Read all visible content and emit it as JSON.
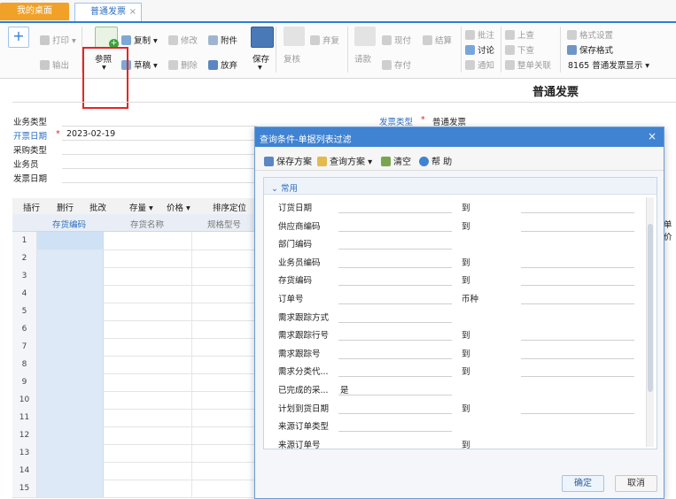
{
  "tabs": [
    {
      "label": "我的桌面"
    },
    {
      "label": "普通发票",
      "close": "×"
    }
  ],
  "toolbar": {
    "add": "+",
    "print": "打印",
    "export": "输出",
    "reference": "参照",
    "copy": "复制",
    "draft": "草稿",
    "modify": "修改",
    "delete": "删除",
    "attach": "附件",
    "abandon": "放弃",
    "save": "保存",
    "audit": "复核",
    "archive": "弃复",
    "cash": "现付",
    "settle": "结算",
    "check": "请款",
    "deposit": "存付",
    "annotate": "批注",
    "discuss": "讨论",
    "notify": "通知",
    "prev": "上查",
    "next": "下查",
    "link": "整单关联",
    "format_settings": "格式设置",
    "save_format": "保存格式",
    "format_select": "8165 普通发票显示"
  },
  "header": {
    "title": "普通发票",
    "fields": {
      "biz_type": "业务类型",
      "invoice_date_label": "开票日期",
      "invoice_date": "2023-02-19",
      "purchase_type": "采购类型",
      "salesman": "业务员",
      "ship_date": "发票日期",
      "invoice_type_label": "发票类型",
      "invoice_type": "普通发票",
      "required": "*"
    }
  },
  "grid": {
    "toolbar": [
      "插行",
      "删行",
      "批改",
      "存量",
      "价格",
      "排序定位"
    ],
    "columns": [
      "存货编码",
      "存货名称",
      "规格型号"
    ],
    "right_col": "单价",
    "rows": [
      "1",
      "2",
      "3",
      "4",
      "5",
      "6",
      "7",
      "8",
      "9",
      "10",
      "11",
      "12",
      "13",
      "14",
      "15"
    ]
  },
  "dialog": {
    "title": "查询条件-单据列表过滤",
    "close": "×",
    "tools": {
      "save_plan": "保存方案",
      "query_plan": "查询方案",
      "clear": "清空",
      "help": "帮 助"
    },
    "section": "常用",
    "fields": [
      {
        "label": "订货日期",
        "to": "到"
      },
      {
        "label": "供应商编码",
        "to": "到"
      },
      {
        "label": "部门编码",
        "to": ""
      },
      {
        "label": "业务员编码",
        "to": "到"
      },
      {
        "label": "存货编码",
        "to": "到"
      },
      {
        "label": "订单号",
        "to": "币种"
      },
      {
        "label": "需求跟踪方式",
        "to": ""
      },
      {
        "label": "需求跟踪行号",
        "to": "到"
      },
      {
        "label": "需求跟踪号",
        "to": "到"
      },
      {
        "label": "需求分类代...",
        "to": "到"
      },
      {
        "label": "已完成的采...",
        "value": "是",
        "to": ""
      },
      {
        "label": "计划到货日期",
        "to": "到"
      },
      {
        "label": "来源订单类型",
        "to": ""
      },
      {
        "label": "来源订单号",
        "to": "到"
      }
    ],
    "ok": "确定",
    "cancel": "取消"
  }
}
